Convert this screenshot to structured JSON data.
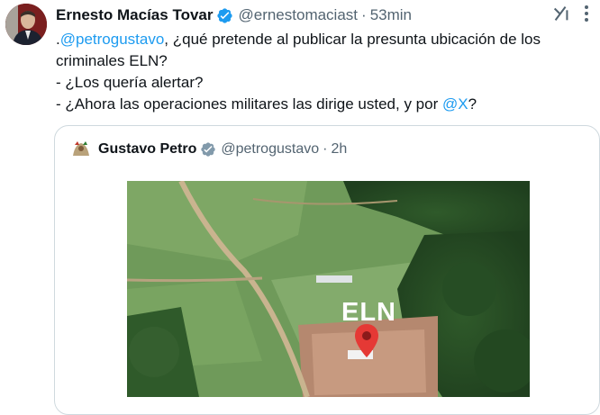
{
  "tweet": {
    "author_name": "Ernesto Macías Tovar",
    "handle": "@ernestomaciast",
    "separator": "·",
    "time": "53min",
    "text": {
      "line1_prefix": ".",
      "line1_mention": "@petrogustavo",
      "line1_rest": ", ¿qué pretende al publicar la presunta ubicación de los criminales ELN?",
      "line2": "- ¿Los quería alertar?",
      "line3_prefix": "- ¿Ahora las operaciones militares las dirige usted, y por ",
      "line3_mention": "@X",
      "line3_suffix": "?"
    },
    "icons": {
      "verified": "verified-badge-icon",
      "grok": "grok-icon",
      "more": "more-icon"
    }
  },
  "quote": {
    "author_name": "Gustavo Petro",
    "handle": "@petrogustavo",
    "separator": "·",
    "time": "2h",
    "image_label": "ELN"
  },
  "colors": {
    "accent": "#1d9bf0",
    "text_primary": "#0f1419",
    "text_secondary": "#536471",
    "border": "#cfd9de",
    "pin": "#e53935"
  }
}
